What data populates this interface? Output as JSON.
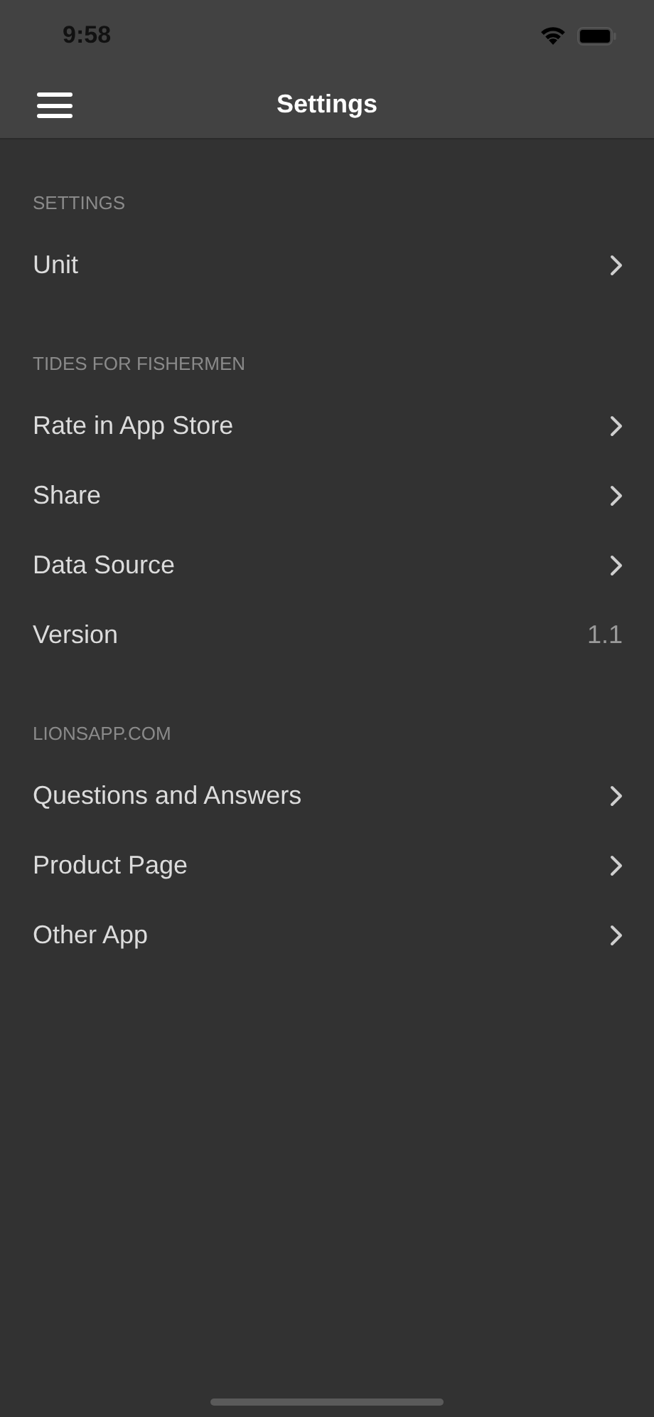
{
  "status_bar": {
    "time": "9:58"
  },
  "nav_bar": {
    "title": "Settings"
  },
  "sections": [
    {
      "header": "SETTINGS",
      "rows": [
        {
          "kind": "link",
          "label": "Unit"
        }
      ]
    },
    {
      "header": "TIDES FOR FISHERMEN",
      "rows": [
        {
          "kind": "link",
          "label": "Rate in App Store"
        },
        {
          "kind": "link",
          "label": "Share"
        },
        {
          "kind": "link",
          "label": "Data Source"
        },
        {
          "kind": "value",
          "label": "Version",
          "value": "1.1"
        }
      ]
    },
    {
      "header": "LIONSAPP.COM",
      "rows": [
        {
          "kind": "link",
          "label": "Questions and Answers"
        },
        {
          "kind": "link",
          "label": "Product Page"
        },
        {
          "kind": "link",
          "label": "Other App"
        }
      ]
    }
  ]
}
